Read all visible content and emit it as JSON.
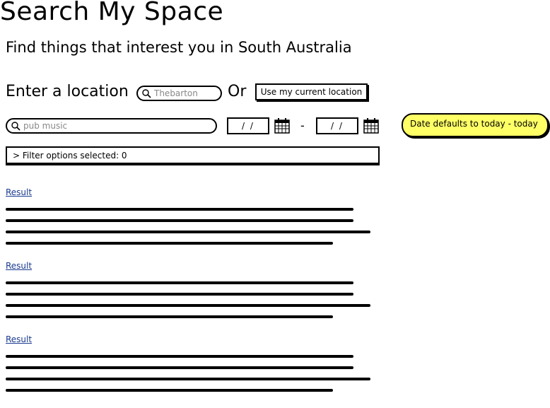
{
  "page": {
    "title": "Search My Space",
    "subtitle": "Find things that interest you in South Australia"
  },
  "location": {
    "label": "Enter a location",
    "search_value": "Thebarton",
    "or_label": "Or",
    "use_current_label": "Use my current location"
  },
  "search": {
    "keyword_value": "pub music",
    "date_from": "/ /",
    "date_separator": "-",
    "date_to": "/ /",
    "note": "Date defaults to today - today"
  },
  "filter": {
    "label": "> Filter options selected: 0"
  },
  "results": [
    {
      "link": "Result"
    },
    {
      "link": "Result"
    },
    {
      "link": "Result"
    }
  ],
  "icons": {
    "search": "search-icon",
    "calendar": "calendar-icon"
  },
  "colors": {
    "note_background": "#ffff66",
    "link": "#1a3a8f"
  }
}
